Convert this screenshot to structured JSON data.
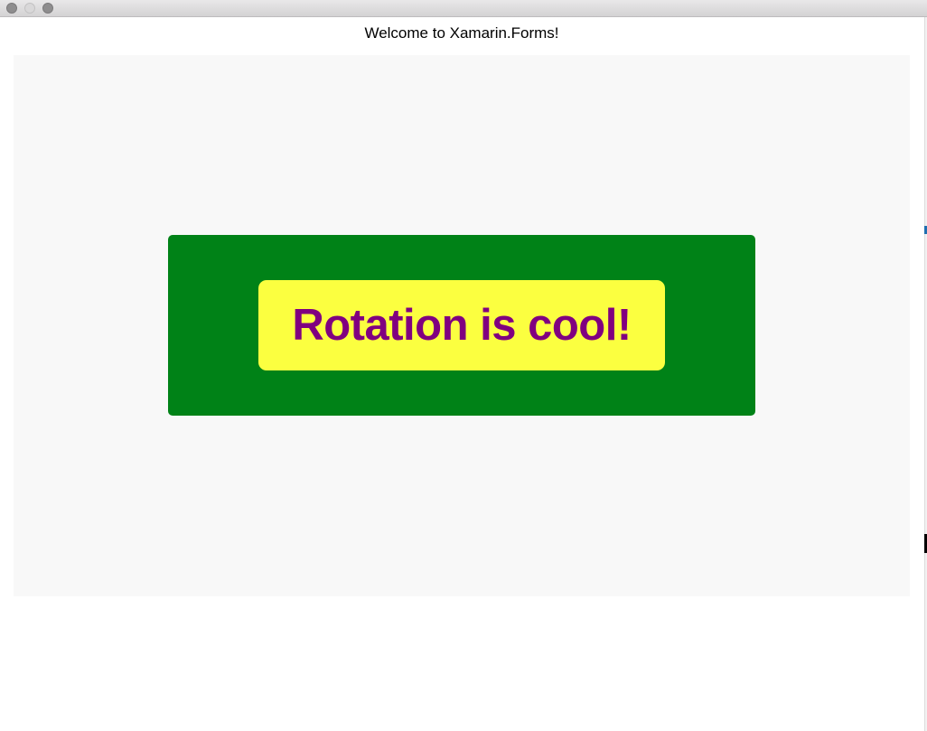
{
  "window": {
    "controls": [
      {
        "name": "close",
        "state": "inactive"
      },
      {
        "name": "minimize",
        "state": "disabled"
      },
      {
        "name": "zoom",
        "state": "inactive"
      }
    ]
  },
  "page": {
    "title": "Welcome to Xamarin.Forms!"
  },
  "frame": {
    "background_color": "#008217",
    "label": {
      "text": "Rotation is cool!",
      "background_color": "#FBFF40",
      "text_color": "#800080"
    }
  },
  "colors": {
    "content_background": "#F8F8F8",
    "window_background": "#FFFFFF"
  }
}
